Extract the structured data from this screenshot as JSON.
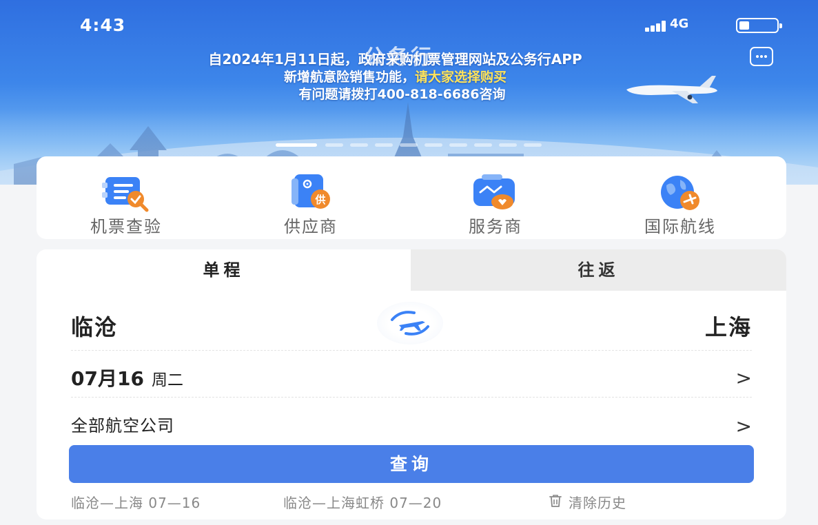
{
  "status_bar": {
    "time": "4:43",
    "network": "4G"
  },
  "banner": {
    "background_title": "公务行",
    "notice_line1": "自2024年1月11日起，政府采购机票管理网站及公务行APP",
    "notice_line2_a": "新增航意险销售功能，",
    "notice_line2_b": "请大家选择购买",
    "notice_line3": "有问题请拨打400-818-6686咨询",
    "page_count": 10,
    "active_page": 1
  },
  "shortcuts": [
    {
      "label": "机票查验",
      "icon": "ticket-check-icon"
    },
    {
      "label": "供应商",
      "icon": "supplier-icon",
      "badge": "供"
    },
    {
      "label": "服务商",
      "icon": "service-provider-icon"
    },
    {
      "label": "国际航线",
      "icon": "international-route-icon"
    }
  ],
  "search": {
    "tabs": [
      "单程",
      "往返"
    ],
    "active_tab": "单程",
    "from_city": "临沧",
    "to_city": "上海",
    "date": "07月16",
    "weekday": "周二",
    "airline": "全部航空公司",
    "chevron": ">",
    "query_button": "查询",
    "history": [
      "临沧—上海 07—16",
      "临沧—上海虹桥 07—20"
    ],
    "clear_history": "清除历史"
  },
  "colors": {
    "accent": "#4a7fe8",
    "banner_top": "#2f6fe0",
    "icon_blue": "#3b82f6",
    "icon_orange": "#f08a2c",
    "highlight_yellow": "#ffe35a"
  }
}
